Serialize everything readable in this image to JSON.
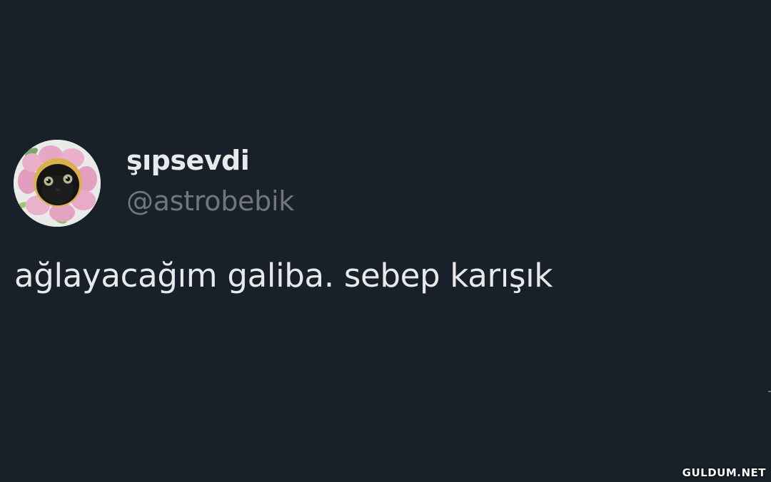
{
  "tweet": {
    "author": {
      "display_name": "şıpsevdi",
      "handle": "@astrobebik",
      "avatar_icon": "kitten-in-flower-costume-avatar"
    },
    "text": "ağlayacağım galiba. sebep karışık"
  },
  "watermark": {
    "text": "GULDUM.NET"
  },
  "colors": {
    "background": "#18202a",
    "primary_text": "#e7e9ea",
    "secondary_text": "#71767b"
  }
}
